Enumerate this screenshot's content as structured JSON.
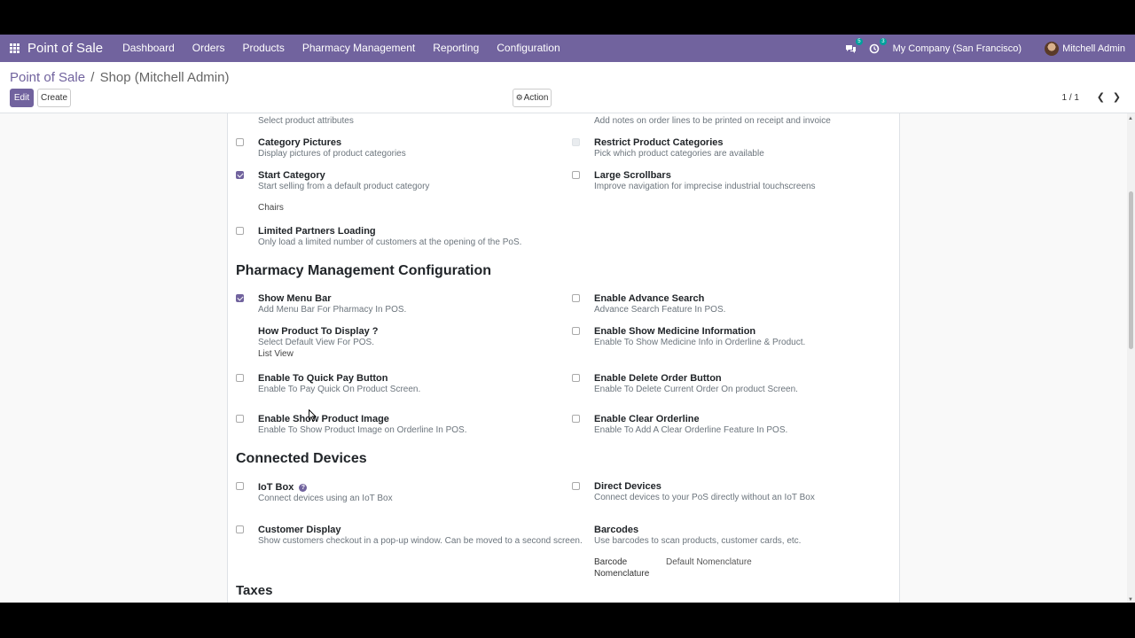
{
  "navbar": {
    "brand": "Point of Sale",
    "menu": [
      "Dashboard",
      "Orders",
      "Products",
      "Pharmacy Management",
      "Reporting",
      "Configuration"
    ],
    "messages_badge": "5",
    "activity_badge": "3",
    "company": "My Company (San Francisco)",
    "user": "Mitchell Admin"
  },
  "control_panel": {
    "breadcrumb_root": "Point of Sale",
    "breadcrumb_sep": "/",
    "breadcrumb_current": "Shop (Mitchell Admin)",
    "edit_label": "Edit",
    "create_label": "Create",
    "action_label": "Action",
    "pager": "1 / 1"
  },
  "form": {
    "top_left_desc": "Select product attributes",
    "top_right_desc": "Add notes on order lines to be printed on receipt and invoice",
    "category_pictures": {
      "title": "Category Pictures",
      "desc": "Display pictures of product categories"
    },
    "restrict_categories": {
      "title": "Restrict Product Categories",
      "desc": "Pick which product categories are available"
    },
    "start_category": {
      "title": "Start Category",
      "desc": "Start selling from a default product category",
      "value": "Chairs"
    },
    "large_scrollbars": {
      "title": "Large Scrollbars",
      "desc": "Improve navigation for imprecise industrial touchscreens"
    },
    "limited_partners": {
      "title": "Limited Partners Loading",
      "desc": "Only load a limited number of customers at the opening of the PoS."
    },
    "pharmacy_section": "Pharmacy Management Configuration",
    "show_menu_bar": {
      "title": "Show Menu Bar",
      "desc": "Add Menu Bar For Pharmacy In POS."
    },
    "advance_search": {
      "title": "Enable Advance Search",
      "desc": "Advance Search Feature In POS."
    },
    "product_display": {
      "title": "How Product To Display ?",
      "desc": "Select Default View For POS.",
      "value": "List View"
    },
    "medicine_info": {
      "title": "Enable Show Medicine Information",
      "desc": "Enable To Show Medicine Info in Orderline & Product."
    },
    "quick_pay": {
      "title": "Enable To Quick Pay Button",
      "desc": "Enable To Pay Quick On Product Screen."
    },
    "delete_order": {
      "title": "Enable Delete Order Button",
      "desc": "Enable To Delete Current Order On product Screen."
    },
    "product_image": {
      "title": "Enable Show Product Image",
      "desc": "Enable To Show Product Image on Orderline In POS."
    },
    "clear_orderline": {
      "title": "Enable Clear Orderline",
      "desc": "Enable To Add A Clear Orderline Feature In POS."
    },
    "devices_section": "Connected Devices",
    "iot_box": {
      "title": "IoT Box",
      "desc": "Connect devices using an IoT Box"
    },
    "direct_devices": {
      "title": "Direct Devices",
      "desc": "Connect devices to your PoS directly without an IoT Box"
    },
    "customer_display": {
      "title": "Customer Display",
      "desc": "Show customers checkout in a pop-up window. Can be moved to a second screen."
    },
    "barcodes": {
      "title": "Barcodes",
      "desc": "Use barcodes to scan products, customer cards, etc.",
      "field_label_1": "Barcode",
      "field_label_2": "Nomenclature",
      "field_value": "Default Nomenclature"
    },
    "taxes_section": "Taxes"
  }
}
